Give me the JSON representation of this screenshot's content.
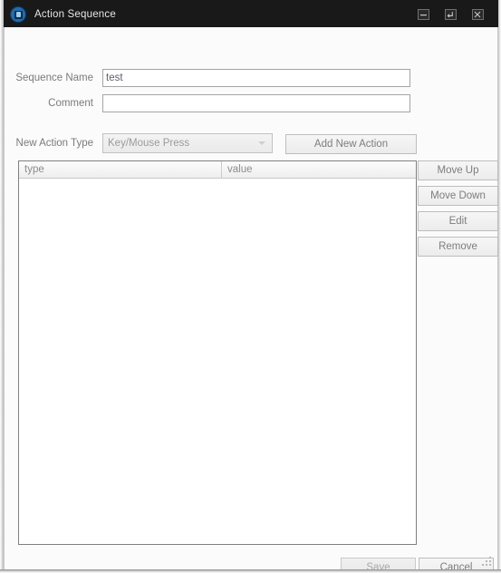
{
  "window": {
    "title": "Action Sequence",
    "icon": "app-icon",
    "controls": [
      {
        "name": "minimize-button",
        "glyph": "minimize-icon",
        "label": "Minimize"
      },
      {
        "name": "restore-button",
        "glyph": "restore-icon",
        "label": "Restore"
      },
      {
        "name": "close-button",
        "glyph": "close-icon",
        "label": "Close"
      }
    ],
    "colors": {
      "titlebar_bg": "#191919",
      "titlebar_text": "#e7e7e7",
      "client_bg": "#fbfbfb",
      "icon_accent": "#1f6cb0",
      "label_text": "#7b7b7b",
      "button_text": "#7d7d7d",
      "list_border": "#7f7f7f"
    }
  },
  "form": {
    "sequence_name": {
      "label": "Sequence Name",
      "value": "test",
      "placeholder": ""
    },
    "comment": {
      "label": "Comment",
      "value": "",
      "placeholder": ""
    },
    "new_action_type": {
      "label": "New Action Type",
      "selected": "Key/Mouse Press",
      "arrow_icon": "chevron-down-icon"
    },
    "add_new_action_label": "Add New Action"
  },
  "list": {
    "columns": [
      {
        "key": "type",
        "label": "type"
      },
      {
        "key": "value",
        "label": "value"
      }
    ],
    "rows": []
  },
  "side_buttons": [
    {
      "name": "move-up-button",
      "label": "Move Up"
    },
    {
      "name": "move-down-button",
      "label": "Move Down"
    },
    {
      "name": "edit-button",
      "label": "Edit"
    },
    {
      "name": "remove-button",
      "label": "Remove"
    }
  ],
  "footer": {
    "save_label": "Save",
    "cancel_label": "Cancel",
    "resize_grip": "resize-grip-icon"
  }
}
